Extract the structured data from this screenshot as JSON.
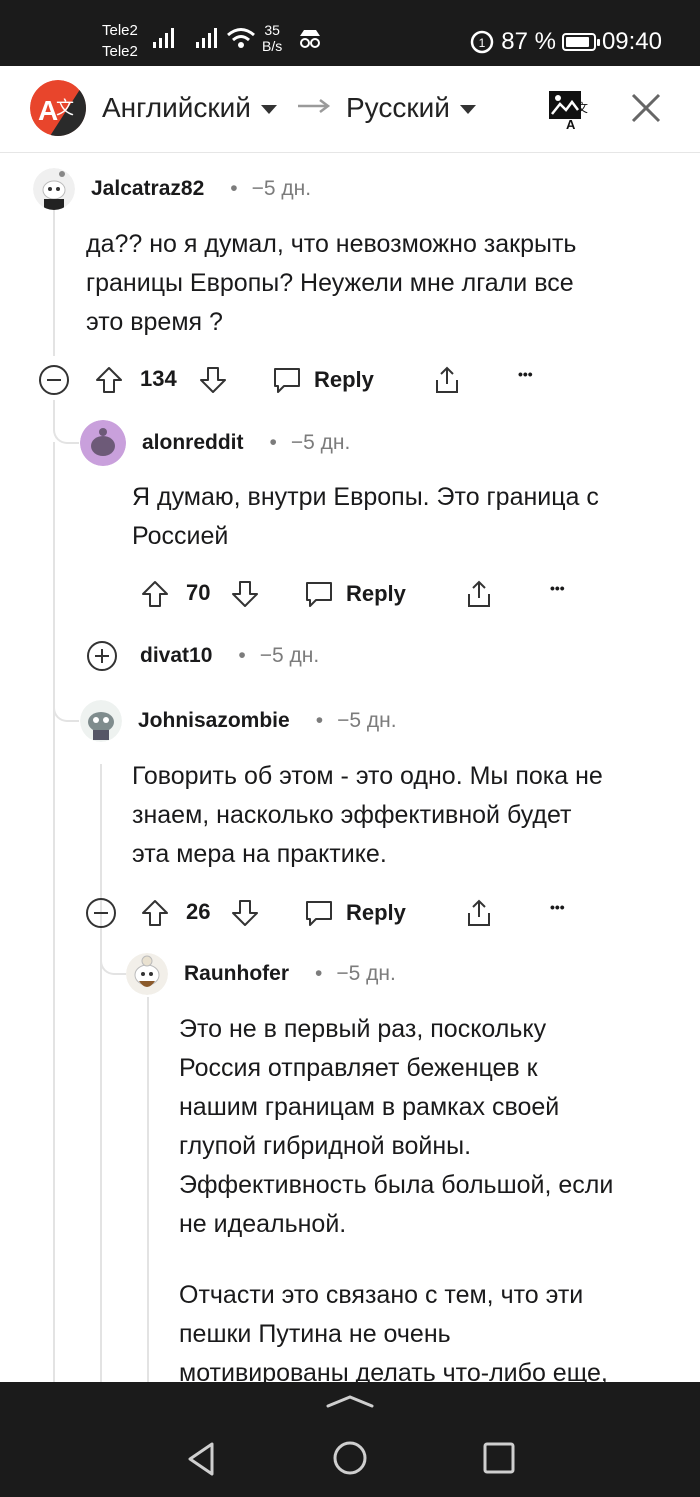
{
  "status_bar": {
    "carrier_1": "Tele2",
    "carrier_2": "Tele2",
    "net_speed": "35",
    "net_unit": "B/s",
    "battery": "87 %",
    "battery_level": 0.87,
    "time": "09:40"
  },
  "translator": {
    "source_lang": "Английский",
    "target_lang": "Русский",
    "icons": [
      "translator-logo-icon",
      "swap-arrow-icon",
      "image-translate-icon",
      "close-icon"
    ]
  },
  "comments": [
    {
      "user": "Jalcatraz82",
      "dot": "•",
      "age": "−5 дн.",
      "lines": [
        "да?? но я думал, что невозможно закрыть",
        "границы Европы? Неужели мне лгали все",
        "это время ?"
      ],
      "votes": "134",
      "reply": "Reply",
      "more": "•••"
    },
    {
      "user": "alonreddit",
      "dot": "•",
      "age": "−5 дн.",
      "lines": [
        "Я думаю, внутри Европы. Это граница с",
        "Россией"
      ],
      "votes": "70",
      "reply": "Reply",
      "more": "•••"
    },
    {
      "user": "divat10",
      "dot": "•",
      "age": "−5 дн."
    },
    {
      "user": "Johnisazombie",
      "dot": "•",
      "age": "−5 дн.",
      "lines": [
        "Говорить об этом - это одно. Мы пока не",
        "знаем, насколько эффективной будет",
        "эта мера на практике."
      ],
      "votes": "26",
      "reply": "Reply",
      "more": "•••"
    },
    {
      "user": "Raunhofer",
      "dot": "•",
      "age": "−5 дн.",
      "lines": [
        "Это не в первый раз, поскольку",
        "Россия отправляет беженцев к",
        "нашим границам в рамках своей",
        "глупой гибридной войны.",
        "Эффективность была большой, если",
        "не идеальной."
      ],
      "lines_2": [
        "Отчасти это связано с тем, что эти",
        "пешки Путина не очень",
        "мотивированы делать что-либо еще,"
      ]
    }
  ],
  "nav_bar": {
    "icons": [
      "back-triangle-icon",
      "home-circle-icon",
      "recents-square-icon",
      "chevron-up-icon"
    ]
  },
  "colors": {
    "status_bg": "#1b1b1b",
    "text": "#1a1a1b",
    "meta": "#7c7c7c",
    "thread": "#e3e3e3",
    "logo_red": "#e8452c"
  }
}
